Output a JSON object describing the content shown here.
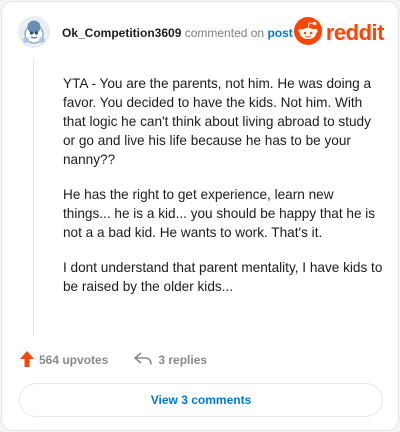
{
  "header": {
    "username": "Ok_Competition3609",
    "action_text": "commented on",
    "post_link": "post",
    "brand": "reddit"
  },
  "comment": {
    "paragraphs": [
      "YTA - You are the parents, not him. He was doing a favor. You decided to have the kids. Not him. With that logic he can't think about living abroad to study or go and live his life because he has to be your nanny??",
      "He has the right to get experience, learn new things... he is a kid... you should be happy that he is not a a bad kid. He wants to work. That's it.",
      "I dont understand that parent mentality, I have kids to be raised by the older kids..."
    ]
  },
  "actions": {
    "upvotes": "564 upvotes",
    "replies": "3 replies"
  },
  "footer": {
    "view_comments": "View 3 comments"
  },
  "colors": {
    "accent_orange": "#ff4500",
    "link_blue": "#0079d3",
    "muted_gray": "#878a8c"
  },
  "icons": {
    "avatar": "avatar-icon",
    "brand_logo": "reddit-snoo-icon",
    "upvote": "upvote-arrow-icon",
    "reply": "reply-arrow-icon"
  }
}
